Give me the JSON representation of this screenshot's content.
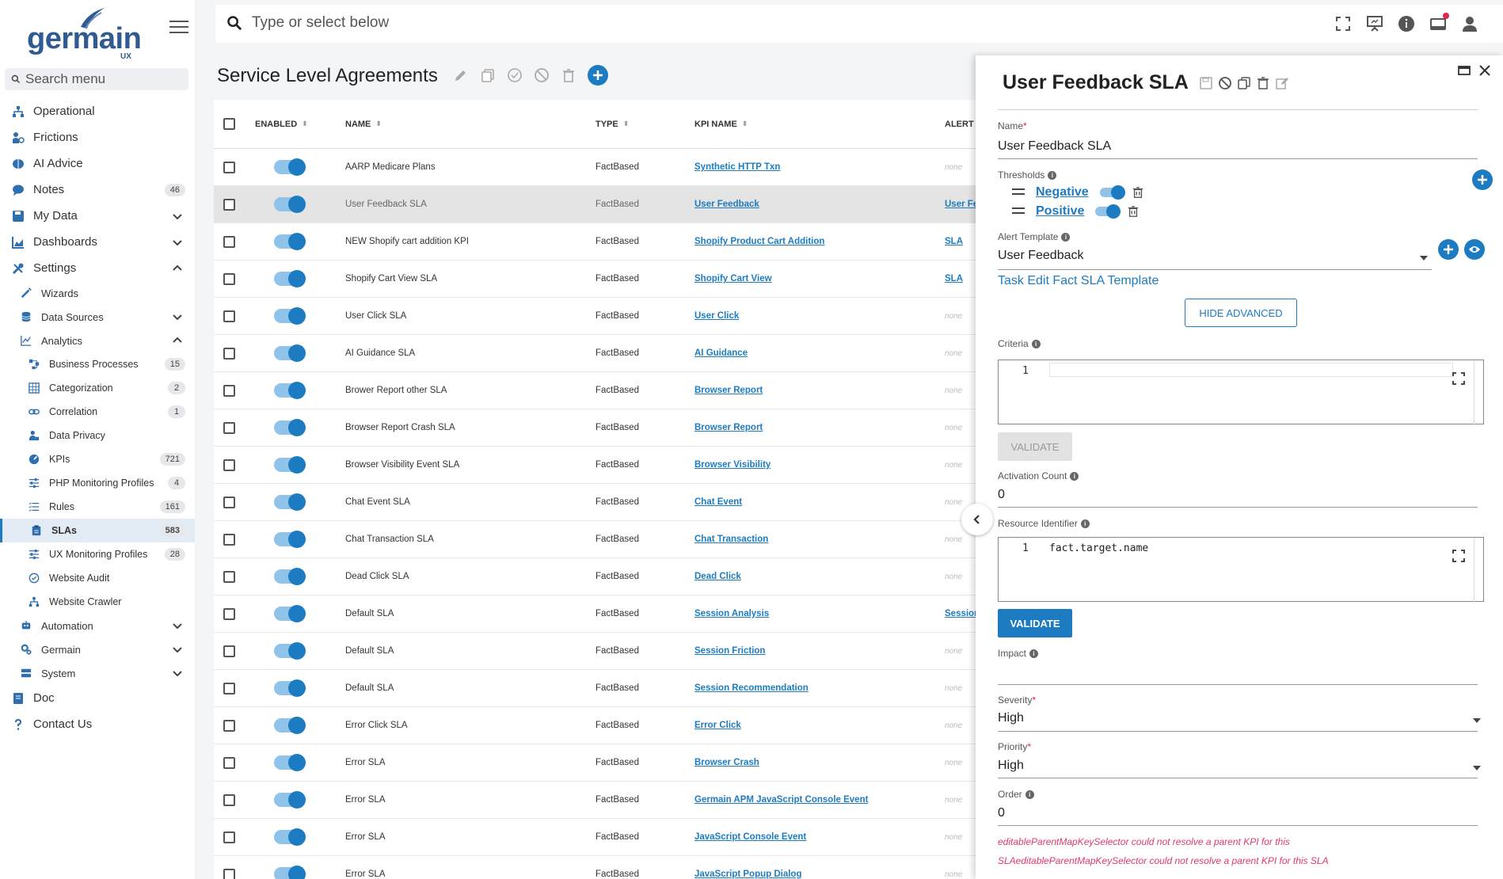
{
  "brand": {
    "name": "germain",
    "sub": "UX"
  },
  "sidebar": {
    "search_placeholder": "Search menu",
    "items": [
      {
        "label": "Operational",
        "icon": "sitemap-icon"
      },
      {
        "label": "Frictions",
        "icon": "user-friction-icon"
      },
      {
        "label": "AI Advice",
        "icon": "brain-icon"
      },
      {
        "label": "Notes",
        "icon": "comment-icon",
        "badge": "46"
      },
      {
        "label": "My Data",
        "icon": "save-icon"
      },
      {
        "label": "Dashboards",
        "icon": "chart-area-icon"
      },
      {
        "label": "Settings",
        "icon": "tools-icon"
      }
    ],
    "settings_children": [
      {
        "label": "Wizards",
        "icon": "wand-icon"
      },
      {
        "label": "Data Sources",
        "icon": "database-icon"
      },
      {
        "label": "Analytics",
        "icon": "line-chart-icon"
      }
    ],
    "analytics_children": [
      {
        "label": "Business Processes",
        "icon": "process-icon",
        "badge": "15"
      },
      {
        "label": "Categorization",
        "icon": "table-icon",
        "badge": "2"
      },
      {
        "label": "Correlation",
        "icon": "link-icon",
        "badge": "1"
      },
      {
        "label": "Data Privacy",
        "icon": "user-lock-icon"
      },
      {
        "label": "KPIs",
        "icon": "gauge-icon",
        "badge": "721"
      },
      {
        "label": "PHP Monitoring Profiles",
        "icon": "sliders-icon",
        "badge": "4"
      },
      {
        "label": "Rules",
        "icon": "list-icon",
        "badge": "161"
      },
      {
        "label": "SLAs",
        "icon": "clipboard-icon",
        "badge": "583"
      },
      {
        "label": "UX Monitoring Profiles",
        "icon": "sliders-icon",
        "badge": "28"
      },
      {
        "label": "Website Audit",
        "icon": "check-circle-icon"
      },
      {
        "label": "Website Crawler",
        "icon": "sitemap-icon"
      }
    ],
    "more_settings": [
      {
        "label": "Automation",
        "icon": "robot-icon"
      },
      {
        "label": "Germain",
        "icon": "cogs-icon"
      },
      {
        "label": "System",
        "icon": "server-icon"
      }
    ],
    "bottom": [
      {
        "label": "Doc",
        "icon": "book-icon"
      },
      {
        "label": "Contact Us",
        "icon": "question-icon"
      }
    ]
  },
  "topbar": {
    "search_placeholder": "Type or select below"
  },
  "main": {
    "title": "Service Level Agreements",
    "columns": {
      "enabled": "ENABLED",
      "name": "NAME",
      "type": "TYPE",
      "kpi": "KPI NAME",
      "alert": "ALERT T"
    },
    "rows": [
      {
        "name": "AARP Medicare Plans",
        "type": "FactBased",
        "kpi": "Synthetic HTTP Txn",
        "alert": "none"
      },
      {
        "name": "User Feedback SLA",
        "type": "FactBased",
        "kpi": "User Feedback",
        "alert": "User Fe"
      },
      {
        "name": "NEW Shopify cart addition KPI",
        "type": "FactBased",
        "kpi": "Shopify Product Cart Addition",
        "alert": "SLA"
      },
      {
        "name": "Shopify Cart View SLA",
        "type": "FactBased",
        "kpi": "Shopify Cart View",
        "alert": "SLA"
      },
      {
        "name": "User Click SLA",
        "type": "FactBased",
        "kpi": "User Click",
        "alert": "none"
      },
      {
        "name": "AI Guidance SLA",
        "type": "FactBased",
        "kpi": "AI Guidance",
        "alert": "none"
      },
      {
        "name": "Brower Report other SLA",
        "type": "FactBased",
        "kpi": "Browser Report",
        "alert": "none"
      },
      {
        "name": "Browser Report Crash SLA",
        "type": "FactBased",
        "kpi": "Browser Report",
        "alert": "none"
      },
      {
        "name": "Browser Visibility Event SLA",
        "type": "FactBased",
        "kpi": "Browser Visibility",
        "alert": "none"
      },
      {
        "name": "Chat Event SLA",
        "type": "FactBased",
        "kpi": "Chat Event",
        "alert": "none"
      },
      {
        "name": "Chat Transaction SLA",
        "type": "FactBased",
        "kpi": "Chat Transaction",
        "alert": "none"
      },
      {
        "name": "Dead Click SLA",
        "type": "FactBased",
        "kpi": "Dead Click",
        "alert": "none"
      },
      {
        "name": "Default SLA",
        "type": "FactBased",
        "kpi": "Session Analysis",
        "alert": "Session"
      },
      {
        "name": "Default SLA",
        "type": "FactBased",
        "kpi": "Session Friction",
        "alert": "none"
      },
      {
        "name": "Default SLA",
        "type": "FactBased",
        "kpi": "Session Recommendation",
        "alert": "none"
      },
      {
        "name": "Error Click SLA",
        "type": "FactBased",
        "kpi": "Error Click",
        "alert": "none"
      },
      {
        "name": "Error SLA",
        "type": "FactBased",
        "kpi": "Browser Crash",
        "alert": "none"
      },
      {
        "name": "Error SLA",
        "type": "FactBased",
        "kpi": "Germain APM JavaScript Console Event",
        "alert": "none"
      },
      {
        "name": "Error SLA",
        "type": "FactBased",
        "kpi": "JavaScript Console Event",
        "alert": "none"
      },
      {
        "name": "Error SLA",
        "type": "FactBased",
        "kpi": "JavaScript Popup Dialog",
        "alert": "none"
      }
    ]
  },
  "panel": {
    "title": "User Feedback SLA",
    "name_label": "Name",
    "name_value": "User Feedback SLA",
    "thresholds_label": "Thresholds",
    "thresholds": [
      {
        "label": "Negative"
      },
      {
        "label": "Positive"
      }
    ],
    "alert_template_label": "Alert Template",
    "alert_template_value": "User Feedback",
    "task_link": "Task Edit Fact SLA Template",
    "hide_advanced": "HIDE ADVANCED",
    "criteria_label": "Criteria",
    "criteria_line": "1",
    "validate_label": "VALIDATE",
    "activation_label": "Activation Count",
    "activation_value": "0",
    "resource_label": "Resource Identifier",
    "resource_line": "1",
    "resource_code": "fact.target.name",
    "impact_label": "Impact",
    "severity_label": "Severity",
    "severity_value": "High",
    "priority_label": "Priority",
    "priority_value": "High",
    "order_label": "Order",
    "order_value": "0",
    "errors": [
      "editableParentMapKeySelector could not resolve a parent KPI for this",
      "SLAeditableParentMapKeySelector could not resolve a parent KPI for this SLA"
    ]
  },
  "colors": {
    "accent": "#1d7cc1",
    "error": "#e03a6a",
    "selected_row": "#e4e4e4"
  }
}
